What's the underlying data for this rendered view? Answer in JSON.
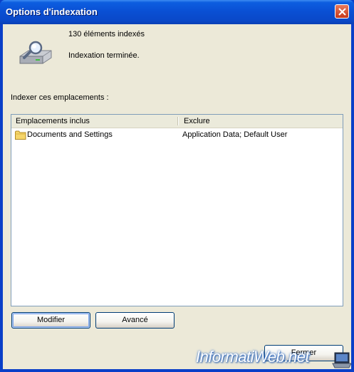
{
  "window": {
    "title": "Options d'indexation"
  },
  "status": {
    "indexed_count": "130 éléments indexés",
    "state": "Indexation terminée."
  },
  "locations": {
    "label": "Indexer ces emplacements :",
    "columns": [
      "Emplacements inclus",
      "Exclure"
    ],
    "rows": [
      {
        "included": "Documents and Settings",
        "exclude": "Application Data; Default User"
      }
    ]
  },
  "buttons": {
    "modify": "Modifier",
    "advanced": "Avancé",
    "close": "Fermer"
  },
  "watermark": "InformatiWeb.net",
  "icons": [
    "search-drive-icon",
    "folder-icon",
    "close-icon",
    "laptop-icon"
  ],
  "colors": {
    "title_bar": "#0a50d4",
    "dialog_bg": "#ece9d8",
    "list_border": "#7f9db9"
  }
}
